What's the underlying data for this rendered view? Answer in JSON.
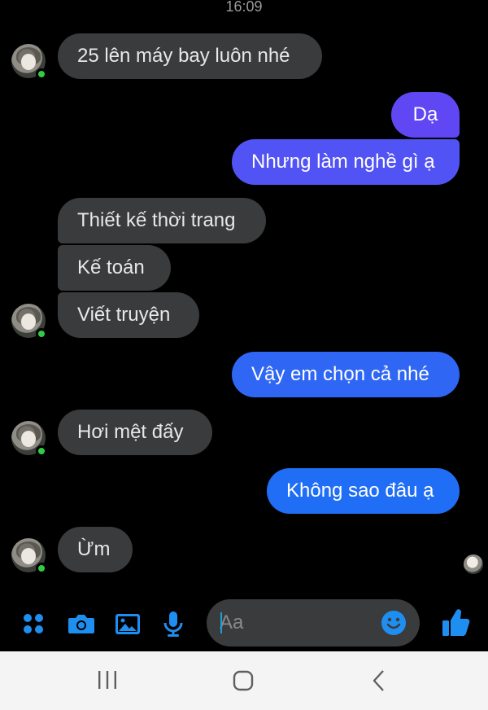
{
  "status_bar": {
    "time": "16:09"
  },
  "messages": [
    {
      "text": "25 lên máy bay luôn nhé",
      "sender": "them"
    },
    {
      "text": "Dạ",
      "sender": "me"
    },
    {
      "text": "Nhưng làm nghề gì ạ",
      "sender": "me"
    },
    {
      "text": "Thiết kế thời trang",
      "sender": "them"
    },
    {
      "text": "Kế toán",
      "sender": "them"
    },
    {
      "text": "Viết truyện",
      "sender": "them"
    },
    {
      "text": "Vậy em chọn cả nhé",
      "sender": "me"
    },
    {
      "text": "Hơi mệt đấy",
      "sender": "them"
    },
    {
      "text": "Không sao đâu ạ",
      "sender": "me"
    },
    {
      "text": "Ừm",
      "sender": "them"
    }
  ],
  "composer": {
    "placeholder": "Aa",
    "tools": [
      "apps-grid-icon",
      "camera-icon",
      "gallery-icon",
      "microphone-icon"
    ],
    "emoji_icon": "smiley-icon",
    "send_icon": "thumbs-up-icon"
  },
  "nav_bar": {
    "buttons": [
      "recent-apps-icon",
      "home-icon",
      "back-icon"
    ]
  },
  "colors": {
    "background": "#000000",
    "incoming_bubble": "#3a3b3c",
    "outgoing_gradient_top": "#6a3cf5",
    "outgoing_gradient_bottom": "#1f6ef5",
    "accent": "#1f8ef1",
    "online": "#31cc46"
  }
}
